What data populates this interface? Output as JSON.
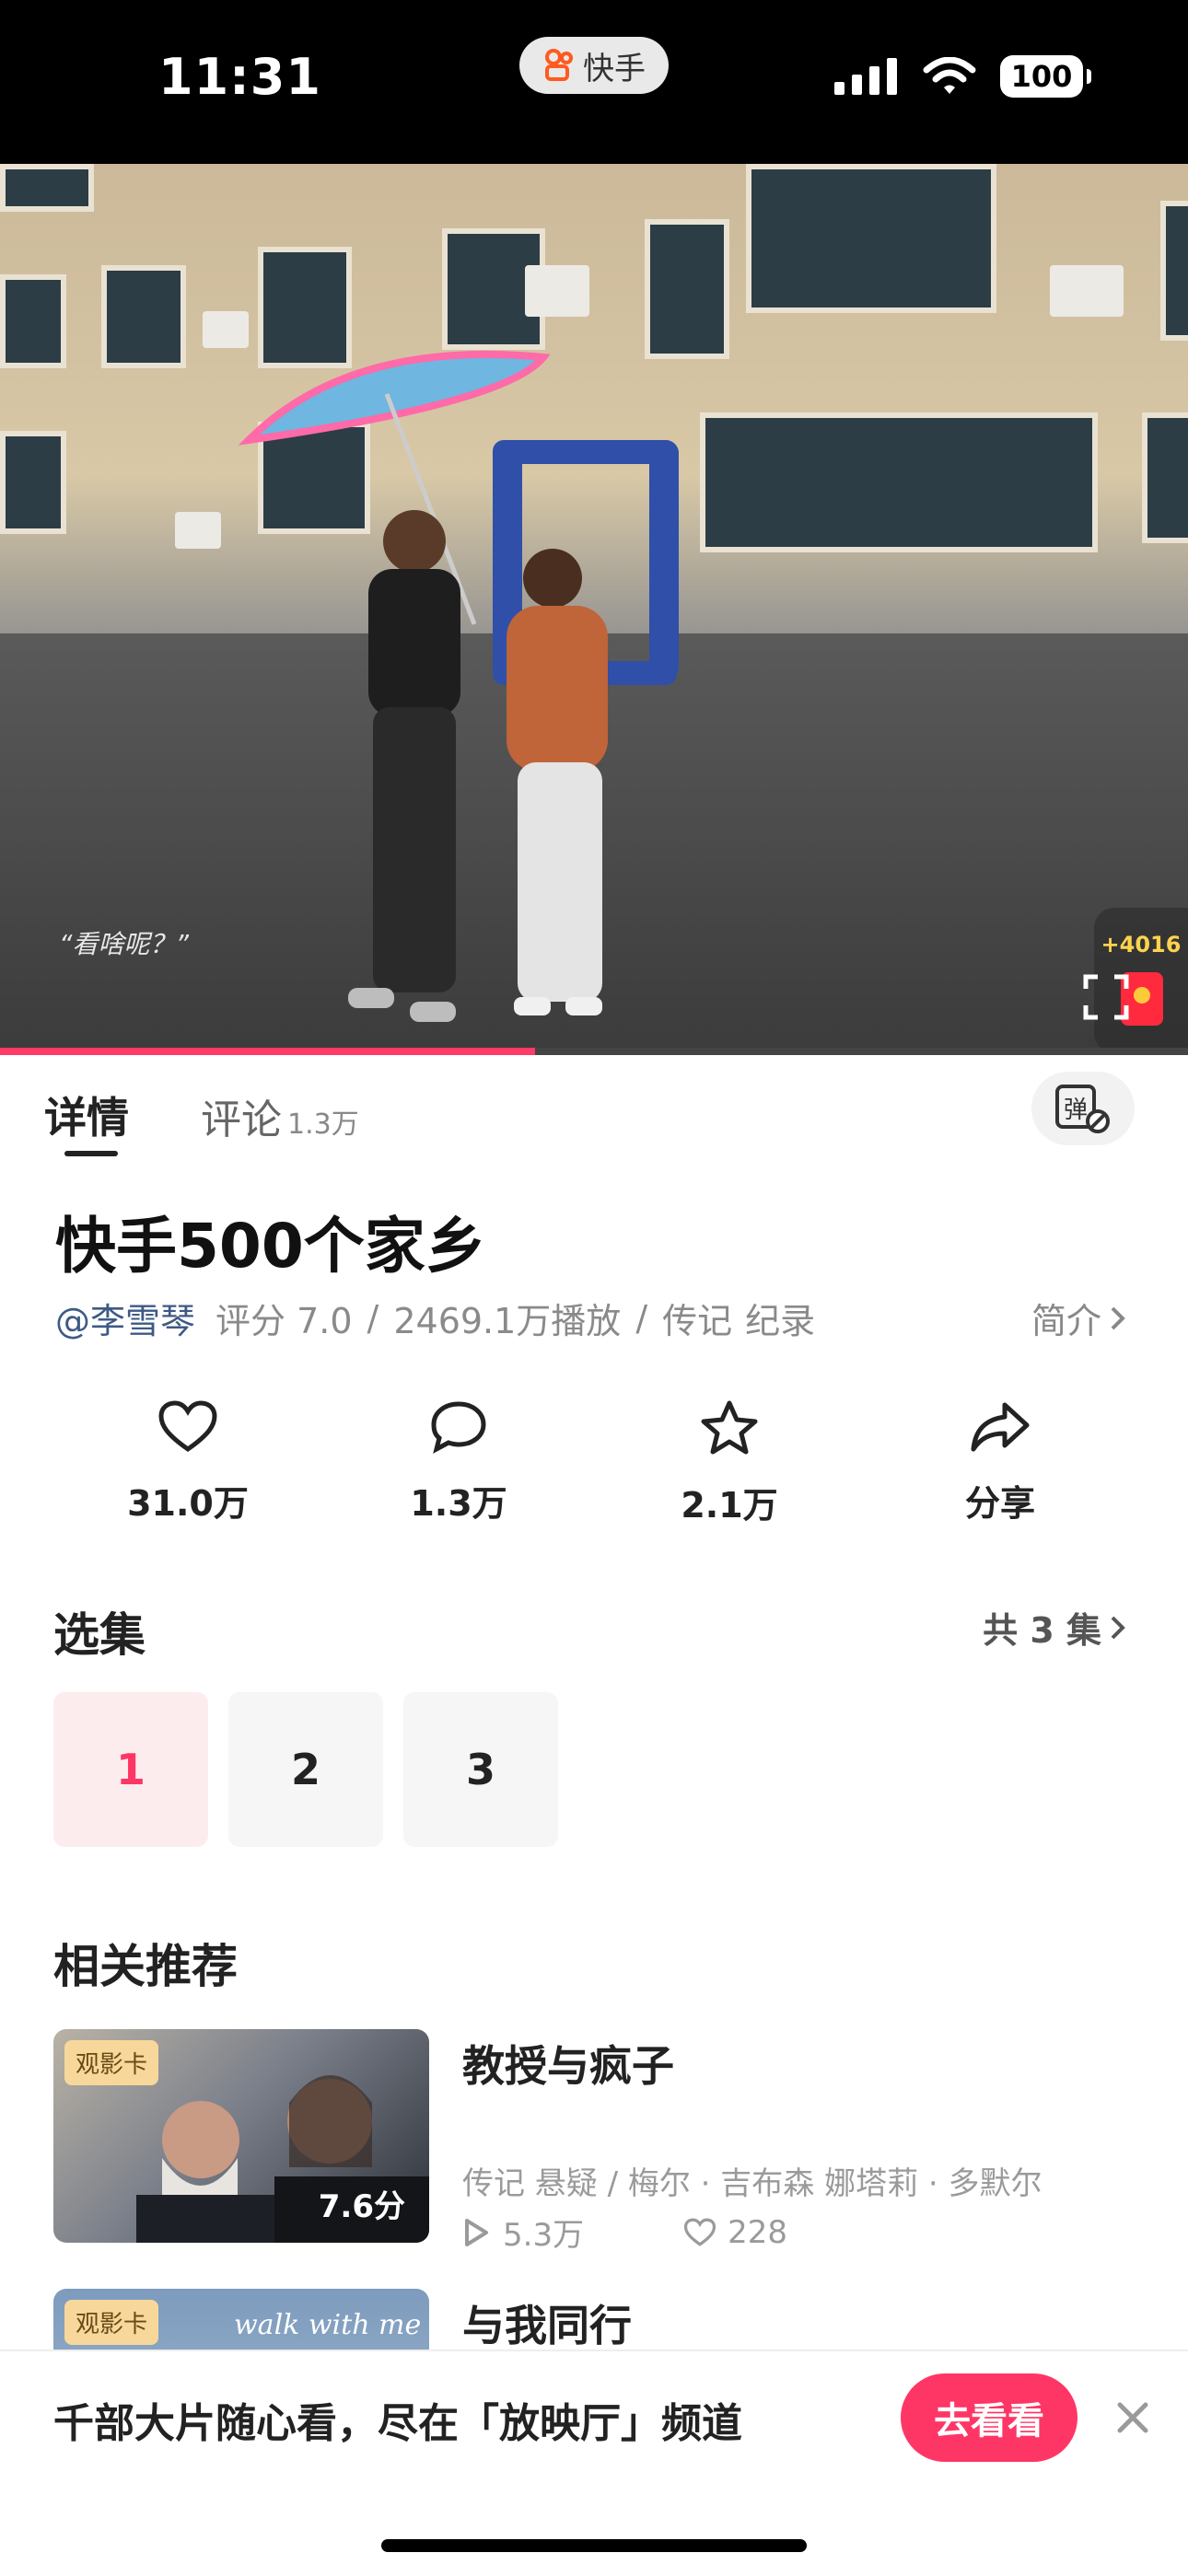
{
  "status_bar": {
    "time": "11:31",
    "app_pill": "快手",
    "battery": "100"
  },
  "video": {
    "subtitle": "“看啥呢？”",
    "reward_count": "+4016",
    "progress_fraction": 0.45
  },
  "tabs": {
    "detail": "详情",
    "comments": "评论",
    "comments_count": "1.3万",
    "danmaku_icon": "弹"
  },
  "show": {
    "title": "快手500个家乡",
    "author": "@李雪琴",
    "rating": "评分 7.0",
    "sep1": "/",
    "plays": "2469.1万播放",
    "sep2": "/",
    "tags": [
      "传记",
      "纪录"
    ],
    "intro_label": "简介"
  },
  "actions": [
    {
      "icon": "heart-icon",
      "label": "31.0万"
    },
    {
      "icon": "comment-icon",
      "label": "1.3万"
    },
    {
      "icon": "star-icon",
      "label": "2.1万"
    },
    {
      "icon": "share-icon",
      "label": "分享"
    }
  ],
  "episodes": {
    "section_title": "选集",
    "total_label": "共 3 集",
    "items": [
      "1",
      "2",
      "3"
    ],
    "active_index": 0
  },
  "recommendations": {
    "section_title": "相关推荐",
    "items": [
      {
        "badge": "观影卡",
        "score": "7.6分",
        "title": "教授与疯子",
        "meta": "传记 悬疑 / 梅尔 · 吉布森 娜塔莉 · 多默尔",
        "plays": "5.3万",
        "likes": "228"
      },
      {
        "badge": "观影卡",
        "poster_text": "walk with me",
        "title": "与我同行"
      }
    ]
  },
  "banner": {
    "text": "千部大片随心看，尽在「放映厅」频道",
    "button": "去看看"
  },
  "colors": {
    "accent": "#fe3666",
    "author_link": "#3d5a85"
  }
}
